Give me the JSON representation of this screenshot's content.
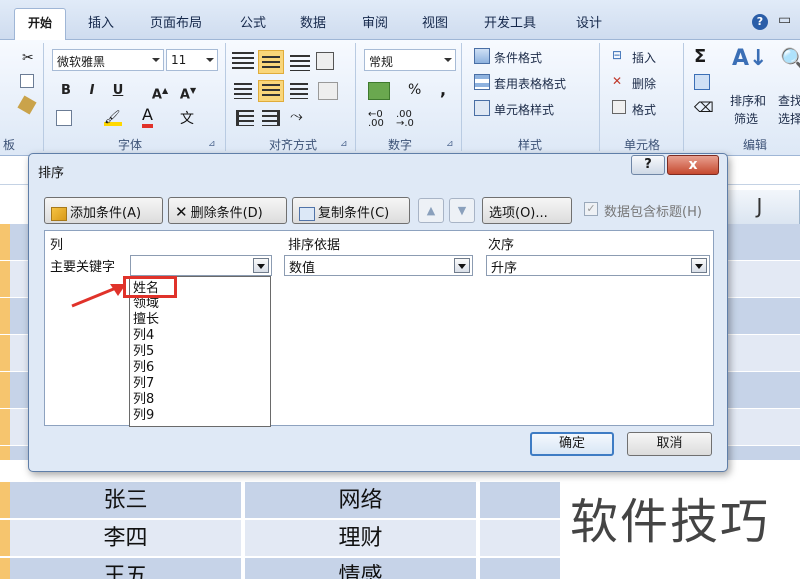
{
  "ribbon": {
    "tabs": [
      "开始",
      "插入",
      "页面布局",
      "公式",
      "数据",
      "审阅",
      "视图",
      "开发工具",
      "设计"
    ],
    "font_name": "微软雅黑",
    "font_size": "11",
    "number_format": "常规",
    "percent": "%",
    "comma": ",",
    "wen": "文",
    "styles": {
      "conditional": "条件格式",
      "table_format": "套用表格格式",
      "cell_style": "单元格样式"
    },
    "cells": {
      "insert": "插入",
      "delete": "删除",
      "format": "格式"
    },
    "editing": {
      "sort_filter": "排序和",
      "sort_filter2": "筛选",
      "find": "查找",
      "find2": "选择"
    },
    "group_labels": {
      "clipboard": "板",
      "font": "字体",
      "alignment": "对齐方式",
      "number": "数字",
      "styles": "样式",
      "cells": "单元格",
      "editing": "编辑"
    }
  },
  "sheet": {
    "col_j": "J",
    "rows": [
      {
        "name": "张三",
        "field": "网络"
      },
      {
        "name": "李四",
        "field": "理财"
      },
      {
        "name": "王五",
        "field": "情感"
      }
    ]
  },
  "watermark": "软件技巧",
  "dialog": {
    "title": "排序",
    "help": "?",
    "close": "x",
    "buttons": {
      "add": "添加条件(A)",
      "delete": "删除条件(D)",
      "copy": "复制条件(C)",
      "options": "选项(O)..."
    },
    "header_checkbox": "数据包含标题(H)",
    "columns": {
      "col": "列",
      "sort_on": "排序依据",
      "order": "次序"
    },
    "row": {
      "label": "主要关键字",
      "key": "",
      "sort_on": "数值",
      "order": "升序"
    },
    "dropdown_items": [
      "姓名",
      "领域",
      "擅长",
      "列4",
      "列5",
      "列6",
      "列7",
      "列8",
      "列9"
    ],
    "ok": "确定",
    "cancel": "取消"
  },
  "colors": {
    "highlight": "#e0322a",
    "sheet_band": "#c6d3e8",
    "sheet_band_alt": "#e3e9f4"
  }
}
